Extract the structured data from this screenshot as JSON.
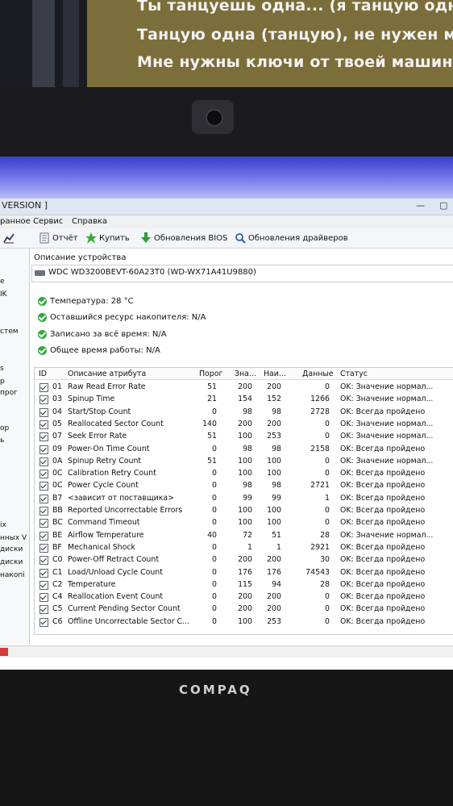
{
  "tv_lyrics": [
    "Ты танцуешь одна... (я танцую одна)",
    "Танцую одна (танцую), не нужен мне т",
    "Мне нужны ключи от твоей машины"
  ],
  "device_brand": "COMPAQ",
  "window": {
    "title": "VERSION ]"
  },
  "menu": {
    "items": [
      "ранное",
      "Сервис",
      "Справка"
    ]
  },
  "toolbar": {
    "report_label": "Отчёт",
    "buy_label": "Купить",
    "bios_updates_label": "Обновления BIOS",
    "driver_updates_label": "Обновления драйверов"
  },
  "sidebar": {
    "items": [
      "е",
      "IK",
      "стем",
      "s",
      "p",
      "прог",
      "ор",
      "ь",
      "іх",
      "нных V",
      "диски",
      "диски",
      "накопі"
    ]
  },
  "device": {
    "section_title": "Описание устройства",
    "name": "WDC WD3200BEVT-60A23T0 (WD-WX71A41U9880)"
  },
  "summary": {
    "temperature": "Температура: 28 °C",
    "remaining_life": "Оставшийся ресурс накопителя: N/A",
    "written_total": "Записано за всё время: N/A",
    "total_uptime": "Общее время работы: N/A"
  },
  "table": {
    "headers": [
      "ID",
      "Описание атрибута",
      "Порог",
      "Зна...",
      "Наи...",
      "Данные",
      "Статус"
    ],
    "rows": [
      {
        "id": "01",
        "name": "Raw Read Error Rate",
        "threshold": "51",
        "value": "200",
        "worst": "200",
        "data": "0",
        "status": "OK: Значение нормал..."
      },
      {
        "id": "03",
        "name": "Spinup Time",
        "threshold": "21",
        "value": "154",
        "worst": "152",
        "data": "1266",
        "status": "OK: Значение нормал..."
      },
      {
        "id": "04",
        "name": "Start/Stop Count",
        "threshold": "0",
        "value": "98",
        "worst": "98",
        "data": "2728",
        "status": "OK: Всегда пройдено"
      },
      {
        "id": "05",
        "name": "Reallocated Sector Count",
        "threshold": "140",
        "value": "200",
        "worst": "200",
        "data": "0",
        "status": "OK: Значение нормал..."
      },
      {
        "id": "07",
        "name": "Seek Error Rate",
        "threshold": "51",
        "value": "100",
        "worst": "253",
        "data": "0",
        "status": "OK: Значение нормал..."
      },
      {
        "id": "09",
        "name": "Power-On Time Count",
        "threshold": "0",
        "value": "98",
        "worst": "98",
        "data": "2158",
        "status": "OK: Всегда пройдено"
      },
      {
        "id": "0A",
        "name": "Spinup Retry Count",
        "threshold": "51",
        "value": "100",
        "worst": "100",
        "data": "0",
        "status": "OK: Значение нормал..."
      },
      {
        "id": "0C",
        "name": "Calibration Retry Count",
        "threshold": "0",
        "value": "100",
        "worst": "100",
        "data": "0",
        "status": "OK: Всегда пройдено"
      },
      {
        "id": "0C",
        "name": "Power Cycle Count",
        "threshold": "0",
        "value": "98",
        "worst": "98",
        "data": "2721",
        "status": "OK: Всегда пройдено"
      },
      {
        "id": "B7",
        "name": "<зависит от поставщика>",
        "threshold": "0",
        "value": "99",
        "worst": "99",
        "data": "1",
        "status": "OK: Всегда пройдено"
      },
      {
        "id": "BB",
        "name": "Reported Uncorrectable Errors",
        "threshold": "0",
        "value": "100",
        "worst": "100",
        "data": "0",
        "status": "OK: Всегда пройдено"
      },
      {
        "id": "BC",
        "name": "Command Timeout",
        "threshold": "0",
        "value": "100",
        "worst": "100",
        "data": "0",
        "status": "OK: Всегда пройдено"
      },
      {
        "id": "BE",
        "name": "Airflow Temperature",
        "threshold": "40",
        "value": "72",
        "worst": "51",
        "data": "28",
        "status": "OK: Значение нормал..."
      },
      {
        "id": "BF",
        "name": "Mechanical Shock",
        "threshold": "0",
        "value": "1",
        "worst": "1",
        "data": "2921",
        "status": "OK: Всегда пройдено"
      },
      {
        "id": "C0",
        "name": "Power-Off Retract Count",
        "threshold": "0",
        "value": "200",
        "worst": "200",
        "data": "30",
        "status": "OK: Всегда пройдено"
      },
      {
        "id": "C1",
        "name": "Load/Unload Cycle Count",
        "threshold": "0",
        "value": "176",
        "worst": "176",
        "data": "74543",
        "status": "OK: Всегда пройдено"
      },
      {
        "id": "C2",
        "name": "Temperature",
        "threshold": "0",
        "value": "115",
        "worst": "94",
        "data": "28",
        "status": "OK: Всегда пройдено"
      },
      {
        "id": "C4",
        "name": "Reallocation Event Count",
        "threshold": "0",
        "value": "200",
        "worst": "200",
        "data": "0",
        "status": "OK: Всегда пройдено"
      },
      {
        "id": "C5",
        "name": "Current Pending Sector Count",
        "threshold": "0",
        "value": "200",
        "worst": "200",
        "data": "0",
        "status": "OK: Всегда пройдено"
      },
      {
        "id": "C6",
        "name": "Offline Uncorrectable Sector C...",
        "threshold": "0",
        "value": "100",
        "worst": "253",
        "data": "0",
        "status": "OK: Всегда пройдено"
      }
    ]
  }
}
